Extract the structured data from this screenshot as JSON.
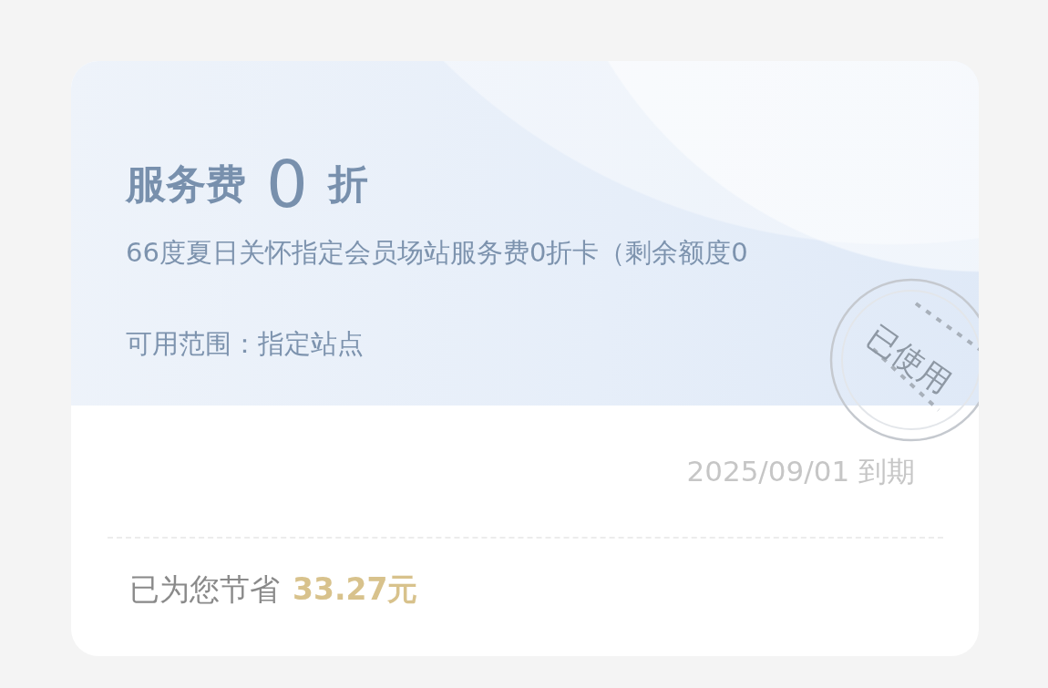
{
  "coupon": {
    "title": "服务费",
    "value": "0",
    "unit": "折",
    "description": "66度夏日关怀指定会员场站服务费0折卡（剩余额度0",
    "scope": "可用范围：指定站点",
    "stamp": "已使用",
    "expiry": "2025/09/01 到期",
    "savings_label": "已为您节省",
    "savings_amount": "33.27元"
  }
}
